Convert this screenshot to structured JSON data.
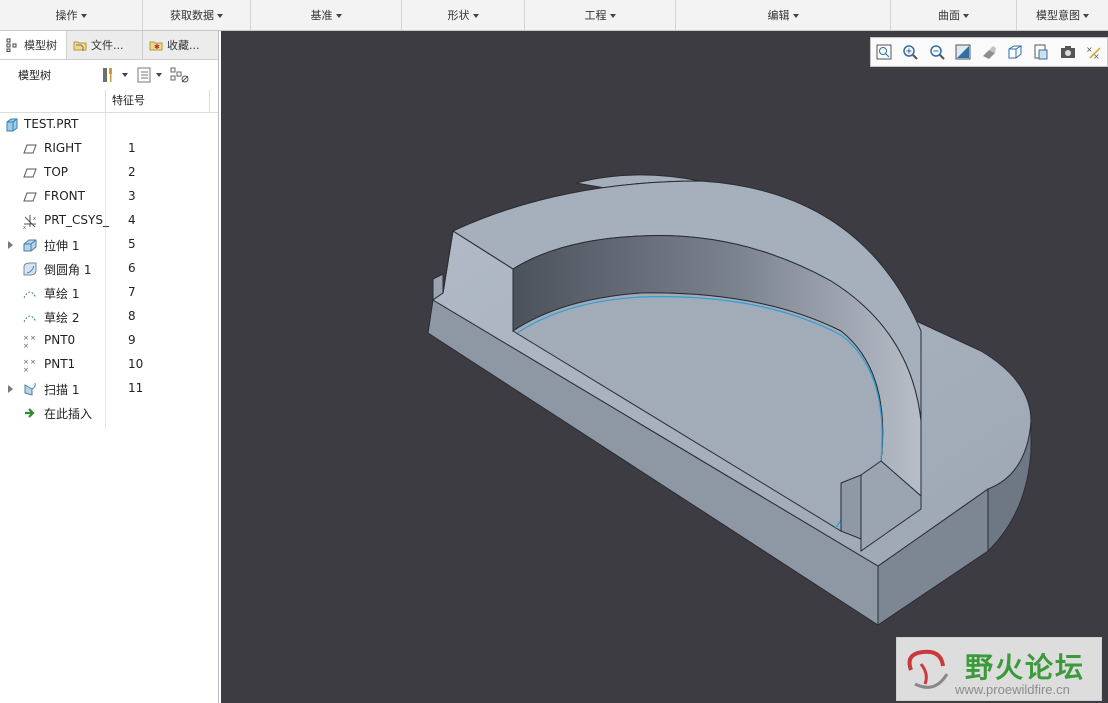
{
  "ribbon": {
    "groups": [
      "操作",
      "获取数据",
      "基准",
      "形状",
      "工程",
      "编辑",
      "曲面",
      "模型意图"
    ]
  },
  "left_panel": {
    "tabs": [
      "模型树",
      "文件...",
      "收藏..."
    ],
    "toolbar_title": "模型树",
    "column_header": "特征号",
    "root": "TEST.PRT",
    "features": [
      {
        "name": "RIGHT",
        "num": "1",
        "icon": "datum-plane-icon"
      },
      {
        "name": "TOP",
        "num": "2",
        "icon": "datum-plane-icon"
      },
      {
        "name": "FRONT",
        "num": "3",
        "icon": "datum-plane-icon"
      },
      {
        "name": "PRT_CSYS_",
        "num": "4",
        "icon": "csys-icon"
      },
      {
        "name": "拉伸 1",
        "num": "5",
        "icon": "extrude-icon"
      },
      {
        "name": "倒圆角 1",
        "num": "6",
        "icon": "round-icon"
      },
      {
        "name": "草绘 1",
        "num": "7",
        "icon": "sketch-icon"
      },
      {
        "name": "草绘 2",
        "num": "8",
        "icon": "sketch-icon"
      },
      {
        "name": "PNT0",
        "num": "9",
        "icon": "datum-point-icon"
      },
      {
        "name": "PNT1",
        "num": "10",
        "icon": "datum-point-icon"
      },
      {
        "name": "扫描 1",
        "num": "11",
        "icon": "sweep-icon"
      }
    ],
    "insert_here": "在此插入"
  },
  "watermark": {
    "name": "野火论坛",
    "url": "www.proewildfire.cn"
  },
  "colors": {
    "viewport_bg": "#3d3c43",
    "model_top": "#a9b2bf",
    "model_side": "#8f99a6",
    "highlight_edge": "#2f9fd8",
    "watermark_green": "#3b9b3b"
  }
}
